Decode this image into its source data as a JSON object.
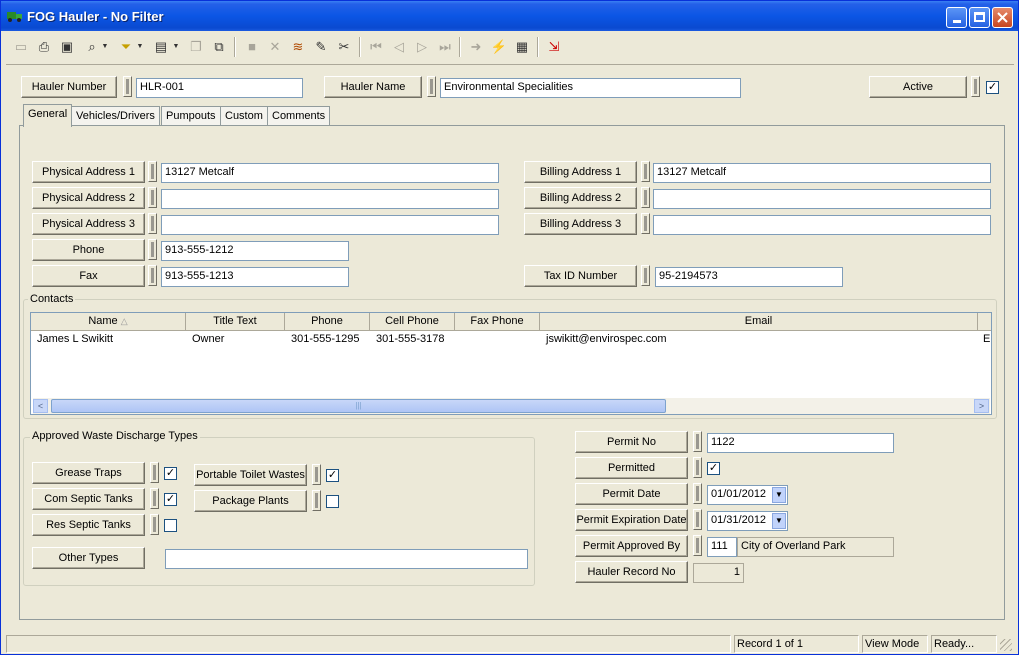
{
  "window": {
    "title": "FOG Hauler - No Filter"
  },
  "header": {
    "hauler_number_label": "Hauler Number",
    "hauler_number": "HLR-001",
    "hauler_name_label": "Hauler Name",
    "hauler_name": "Environmental Specialities",
    "active_label": "Active",
    "active_checked": "✓"
  },
  "tabs": [
    "General",
    "Vehicles/Drivers",
    "Pumpouts",
    "Custom",
    "Comments"
  ],
  "general": {
    "physical_address_1_label": "Physical Address 1",
    "physical_address_1": "13127 Metcalf",
    "physical_address_2_label": "Physical Address 2",
    "physical_address_2": "",
    "physical_address_3_label": "Physical Address 3",
    "physical_address_3": "",
    "phone_label": "Phone",
    "phone": "913-555-1212",
    "fax_label": "Fax",
    "fax": "913-555-1213",
    "billing_address_1_label": "Billing Address 1",
    "billing_address_1": "13127 Metcalf",
    "billing_address_2_label": "Billing Address 2",
    "billing_address_2": "",
    "billing_address_3_label": "Billing Address 3",
    "billing_address_3": "",
    "tax_id_label": "Tax ID Number",
    "tax_id": "95-2194573"
  },
  "contacts": {
    "title": "Contacts",
    "columns": [
      "Name",
      "Title Text",
      "Phone",
      "Cell Phone",
      "Fax Phone",
      "Email"
    ],
    "sort_indicator": "△",
    "rows": [
      {
        "name": "James L Swikitt",
        "title": "Owner",
        "phone": "301-555-1295",
        "cell": "301-555-3178",
        "fax": "",
        "email": "jswikitt@envirospec.com",
        "overflow": "E"
      }
    ],
    "scroll_left": "<",
    "scroll_right": ">",
    "thumb_grip": "|||"
  },
  "waste": {
    "title": "Approved Waste Discharge Types",
    "grease_traps_label": "Grease Traps",
    "grease_traps": "✓",
    "com_septic_label": "Com Septic Tanks",
    "com_septic": "✓",
    "res_septic_label": "Res Septic Tanks",
    "res_septic": "",
    "portable_toilet_label": "Portable Toilet Wastes",
    "portable_toilet": "✓",
    "package_plants_label": "Package Plants",
    "package_plants": "",
    "other_types_label": "Other Types",
    "other_types": ""
  },
  "permit": {
    "permit_no_label": "Permit No",
    "permit_no": "1122",
    "permitted_label": "Permitted",
    "permitted": "✓",
    "permit_date_label": "Permit Date",
    "permit_date": "01/01/2012",
    "permit_expiration_label": "Permit Expiration Date",
    "permit_expiration": "01/31/2012",
    "approved_by_label": "Permit Approved By",
    "approved_by_code": "111",
    "approved_by_name": "City of Overland Park",
    "record_no_label": "Hauler Record No",
    "record_no": "1",
    "combo_arrow": "▼"
  },
  "status": {
    "record": "Record 1 of 1",
    "mode": "View Mode",
    "state": "Ready..."
  },
  "colors": {
    "title_bar": "#0b56e5",
    "face": "#ece9d8",
    "scroll_thumb": "#c8d7f8"
  }
}
